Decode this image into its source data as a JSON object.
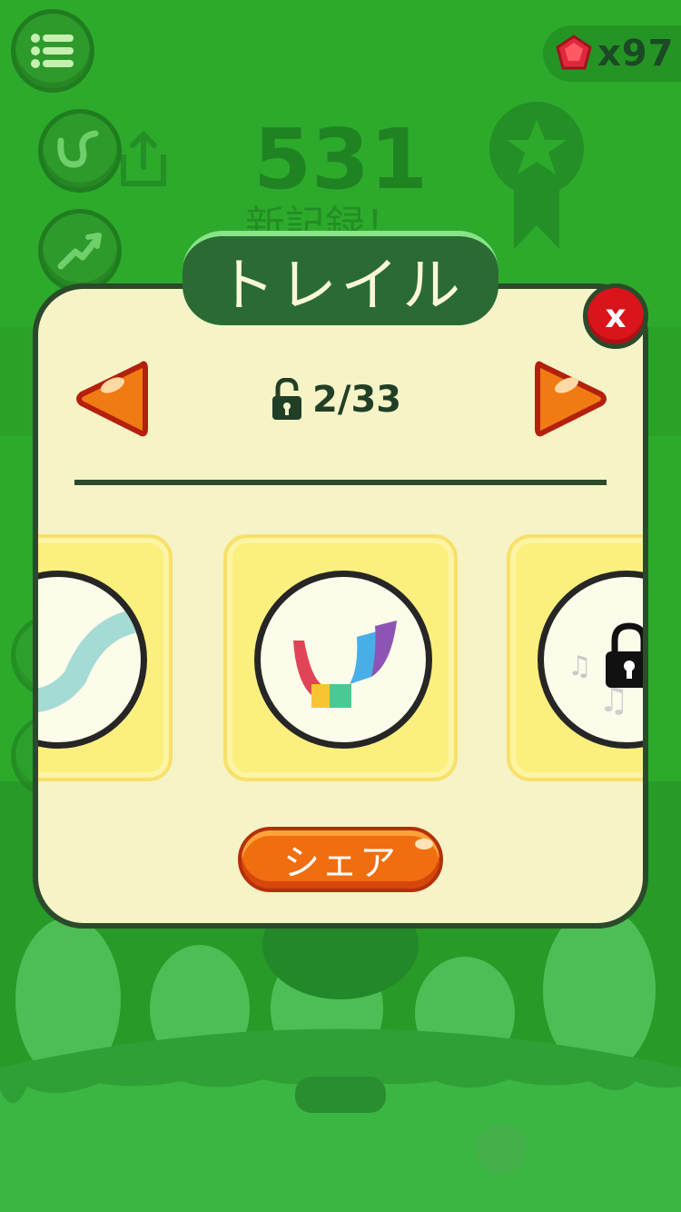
{
  "colors": {
    "background": "#2daa2b",
    "panel": "#f6f3c7",
    "panel_border": "#2b4a2b",
    "title_tab": "#2a6b34",
    "close_button": "#d9141b",
    "arrow": "#f0700f",
    "share_button": "#f06e10",
    "card": "#fbf07e",
    "gem": "#e0283a"
  },
  "hud": {
    "gem_count": "x97",
    "gem_icon": "red-gem-icon",
    "menu_icon": "menu-list-icon",
    "trail_icon": "trail-icon",
    "stats_icon": "chart-up-icon"
  },
  "background_score": {
    "score": "531",
    "record_label": "新記録！",
    "share_icon": "share-icon",
    "badge_icon": "star-ribbon-icon"
  },
  "dialog": {
    "title": "トレイル",
    "close_label": "x",
    "counter": "2/33",
    "counter_icon": "unlock-icon",
    "prev_icon": "arrow-left-icon",
    "next_icon": "arrow-right-icon",
    "share_label": "シェア"
  },
  "trails": [
    {
      "name": "teal-trail",
      "state": "unlocked"
    },
    {
      "name": "rainbow-trail",
      "state": "selected"
    },
    {
      "name": "music-trail",
      "state": "locked"
    }
  ]
}
